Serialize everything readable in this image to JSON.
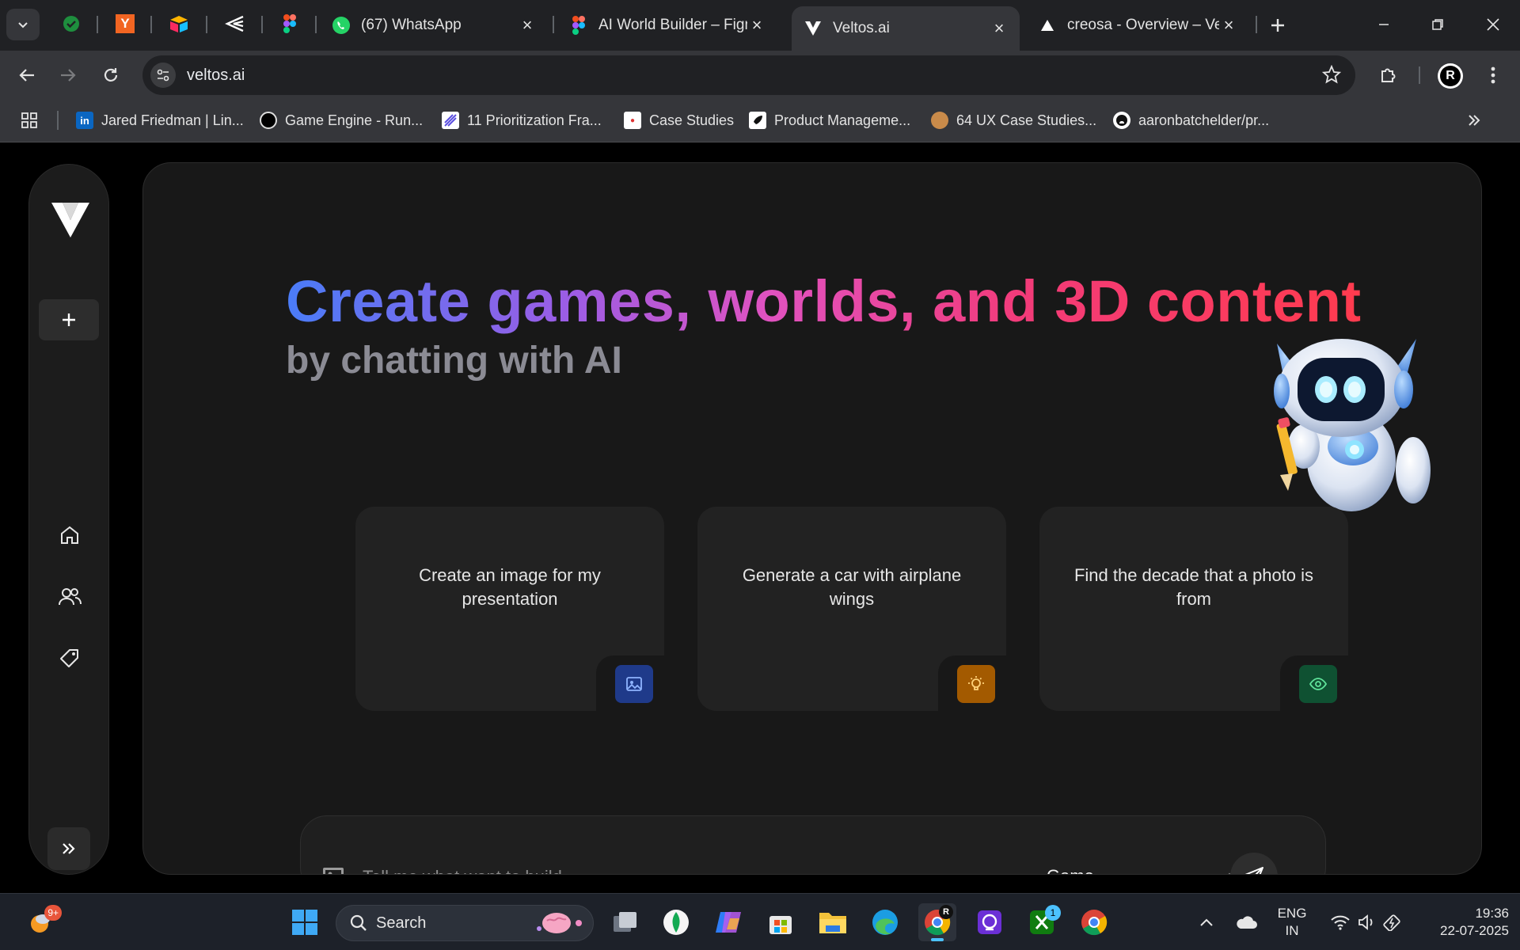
{
  "browser": {
    "tabs": [
      {
        "title": "(67) WhatsApp"
      },
      {
        "title": "AI World Builder – Figma"
      },
      {
        "title": "Veltos.ai"
      },
      {
        "title": "creosa - Overview – Vercel"
      }
    ],
    "url": "veltos.ai",
    "profile_initial": "R",
    "bookmarks": [
      {
        "label": "Jared Friedman | Lin..."
      },
      {
        "label": "Game Engine - Run..."
      },
      {
        "label": "11 Prioritization Fra..."
      },
      {
        "label": "Case Studies"
      },
      {
        "label": "Product Manageme..."
      },
      {
        "label": "64 UX Case Studies..."
      },
      {
        "label": "aaronbatchelder/pr..."
      }
    ]
  },
  "hero": {
    "headline": "Create games, worlds, and 3D content",
    "subline": "by chatting with AI"
  },
  "cards": [
    {
      "text": "Create an image for my presentation",
      "icon": "image-icon",
      "color": "#1f3a8a"
    },
    {
      "text": "Generate a car with airplane wings",
      "icon": "lightbulb-icon",
      "color": "#a35a00"
    },
    {
      "text": "Find the decade that a photo is from",
      "icon": "eye-icon",
      "color": "#0f5132"
    }
  ],
  "composer": {
    "placeholder": "Tell me what want to build",
    "mode": "Game"
  },
  "taskbar": {
    "search_label": "Search",
    "weather_badge": "9+",
    "xbox_badge": "1",
    "lang_top": "ENG",
    "lang_bottom": "IN",
    "time": "19:36",
    "date": "22-07-2025"
  },
  "colors": {
    "accent_blue": "#4a7cf7",
    "accent_pink": "#e052c0",
    "accent_red": "#ff3b4e"
  }
}
